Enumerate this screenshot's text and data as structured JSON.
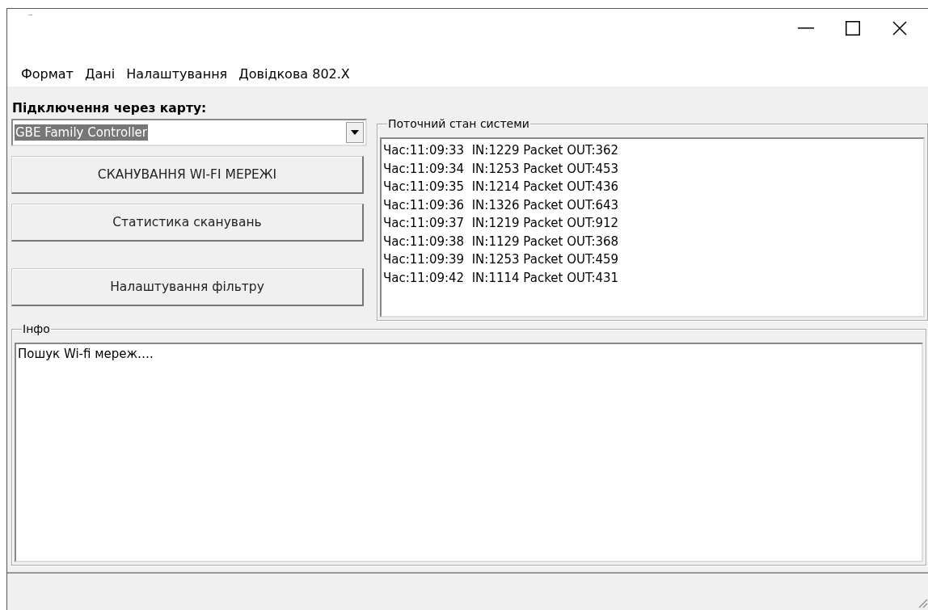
{
  "window": {
    "title_mark": "‾"
  },
  "menu": [
    "Формат",
    "Дані",
    "Налаштування",
    "Довідкова 802.X"
  ],
  "adapter": {
    "label": "Підключення через карту:",
    "value": "GBE Family Controller"
  },
  "buttons": [
    "СКАНУВАННЯ WI-FI МЕРЕЖІ",
    "Статистика сканувань",
    "Налаштування фільтру"
  ],
  "status_group": {
    "title": "Поточний стан системи",
    "lines": [
      "Час:11:09:33  IN:1229 Packet OUT:362",
      "Час:11:09:34  IN:1253 Packet OUT:453",
      "Час:11:09:35  IN:1214 Packet OUT:436",
      "Час:11:09:36  IN:1326 Packet OUT:643",
      "Час:11:09:37  IN:1219 Packet OUT:912",
      "Час:11:09:38  IN:1129 Packet OUT:368",
      "Час:11:09:39  IN:1253 Packet OUT:459",
      "Час:11:09:42  IN:1114 Packet OUT:431"
    ]
  },
  "info_group": {
    "title": "Інфо",
    "text": "Пошук Wi-fi мереж…."
  }
}
